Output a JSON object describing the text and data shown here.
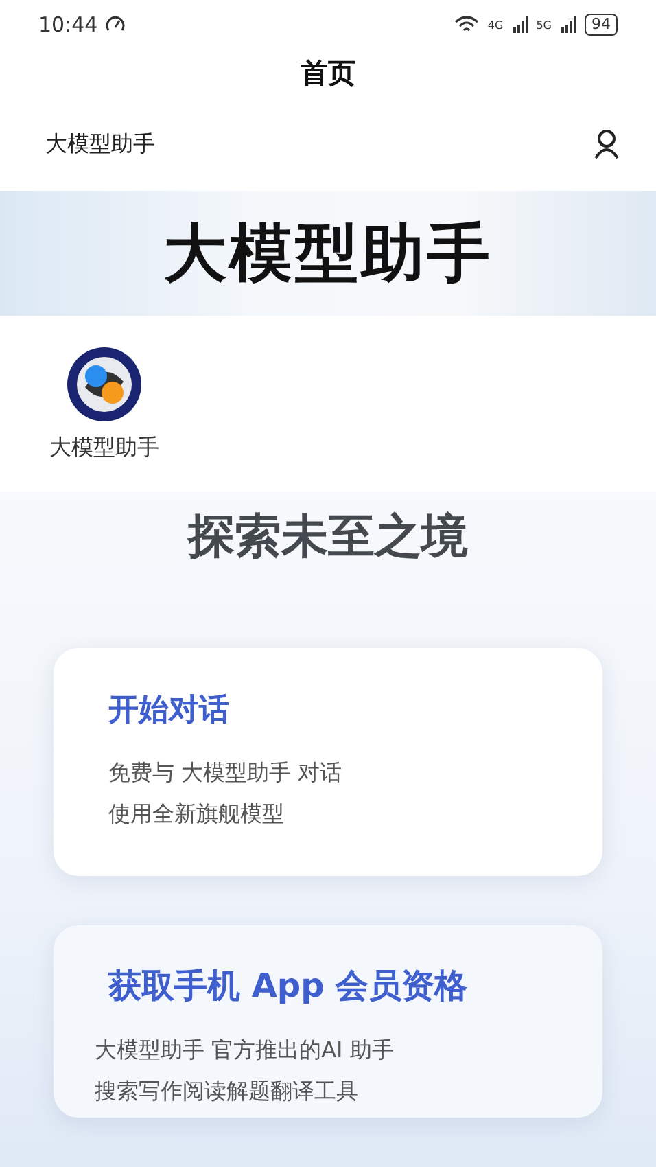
{
  "status_bar": {
    "time": "10:44",
    "battery": "94",
    "network_1": "4G",
    "network_2": "5G"
  },
  "nav": {
    "title": "首页"
  },
  "header": {
    "title": "大模型助手"
  },
  "banner": {
    "title": "大模型助手"
  },
  "apps": [
    {
      "label": "大模型助手"
    }
  ],
  "hero": {
    "title": "探索未至之境"
  },
  "cards": [
    {
      "title": "开始对话",
      "lines": [
        "免费与 大模型助手 对话",
        "使用全新旗舰模型"
      ]
    },
    {
      "title": "获取手机 App 会员资格",
      "lines": [
        "大模型助手 官方推出的AI 助手",
        "搜索写作阅读解题翻译工具"
      ]
    }
  ]
}
